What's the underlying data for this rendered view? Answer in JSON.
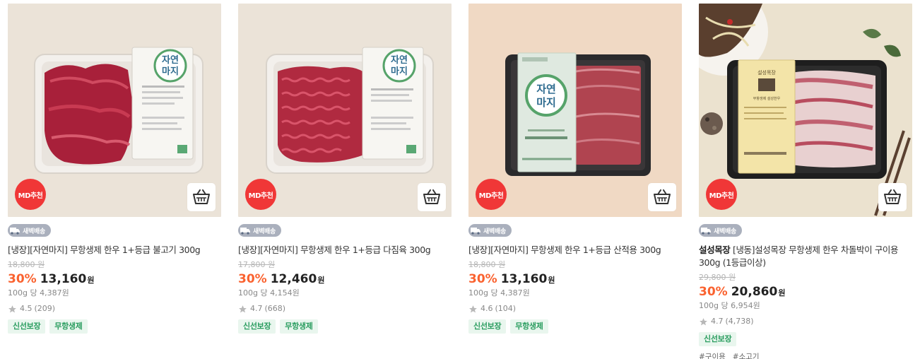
{
  "products": [
    {
      "badge": "MD추천",
      "delivery": "새벽배송",
      "brand": "",
      "name": "[냉장][자연마지] 무항생제 한우 1+등급 불고기 300g",
      "original_price": "18,800 원",
      "discount": "30%",
      "price": "13,160",
      "currency": "원",
      "unit_price": "100g 당 4,387원",
      "rating": "4.5",
      "review_count": "(209)",
      "tags": [
        "신선보장",
        "무항생제"
      ],
      "hashtags": []
    },
    {
      "badge": "MD추천",
      "delivery": "새벽배송",
      "brand": "",
      "name": "[냉장][자연마지] 무항생제 한우 1+등급 다짐육 300g",
      "original_price": "17,800 원",
      "discount": "30%",
      "price": "12,460",
      "currency": "원",
      "unit_price": "100g 당 4,154원",
      "rating": "4.7",
      "review_count": "(668)",
      "tags": [
        "신선보장",
        "무항생제"
      ],
      "hashtags": []
    },
    {
      "badge": "MD추천",
      "delivery": "새벽배송",
      "brand": "",
      "name": "[냉장][자연마지] 무항생제 한우 1+등급 산적용 300g",
      "original_price": "18,800 원",
      "discount": "30%",
      "price": "13,160",
      "currency": "원",
      "unit_price": "100g 당 4,387원",
      "rating": "4.6",
      "review_count": "(104)",
      "tags": [
        "신선보장",
        "무항생제"
      ],
      "hashtags": []
    },
    {
      "badge": "MD추천",
      "delivery": "새벽배송",
      "brand": "설성목장",
      "name": "[냉동]설성목장 무항생제 한우 차돌박이 구이용 300g (1등급이상)",
      "original_price": "29,800 원",
      "discount": "30%",
      "price": "20,860",
      "currency": "원",
      "unit_price": "100g 당 6,954원",
      "rating": "4.7",
      "review_count": "(4,738)",
      "tags": [
        "신선보장"
      ],
      "hashtags": [
        "#구이용",
        "#소고기"
      ]
    }
  ],
  "package_labels": [
    "자연",
    "마지",
    "설성목장",
    "무항생제 설성한우"
  ],
  "colors": {
    "md_badge": "#f03737",
    "discount": "#fa622f",
    "tag_text": "#2a9d5f",
    "tag_bg": "#e9f6ee",
    "delivery_bg": "#aab0bd"
  }
}
